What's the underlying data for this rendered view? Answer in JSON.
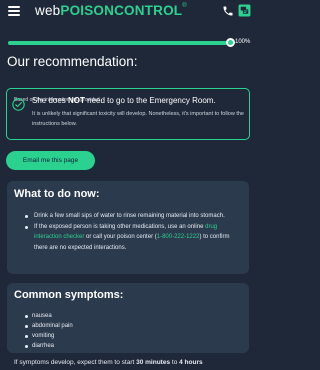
{
  "header": {
    "logo_web": "web",
    "logo_brand": "POISONCONTROL",
    "logo_reg": "®",
    "menu_icon": "hamburger-menu-icon",
    "phone_icon": "phone-icon",
    "chat_icon": "chat-icon"
  },
  "progress": {
    "value": 1.0,
    "label": "100%"
  },
  "recommendation": {
    "title": "Our recommendation:",
    "intro": "Based on the information you provided . . .",
    "headline_pre": "She does ",
    "headline_bold": "NOT",
    "headline_post": " need to go to the Emergency Room.",
    "detail": "It is unlikely that significant toxicity will develop. Nonetheless, it's important to follow the instructions below."
  },
  "email_button": {
    "label": "Email me this page"
  },
  "todo": {
    "title": "What to do now:",
    "item1": "Drink a few small sips of water to rinse remaining material into stomach.",
    "item2_pre": "If the exposed person is taking other medications, use an online ",
    "item2_link": "drug interaction checker",
    "item2_mid": " or call your poison center (",
    "item2_phone": "1-800-222-1222",
    "item2_post": ") to confirm there are no expected interactions."
  },
  "symptoms": {
    "title": "Common symptoms:",
    "items": [
      "nausea",
      "abdominal pain",
      "vomiting",
      "diarrhea"
    ]
  },
  "bottom": {
    "pre": "If symptoms develop, expect them to start ",
    "bold1": "30 minutes",
    "mid": " to ",
    "bold2": "4 hours"
  },
  "colors": {
    "background": "#1f2839",
    "card": "#2c3a4e",
    "accent": "#2bd18e"
  }
}
